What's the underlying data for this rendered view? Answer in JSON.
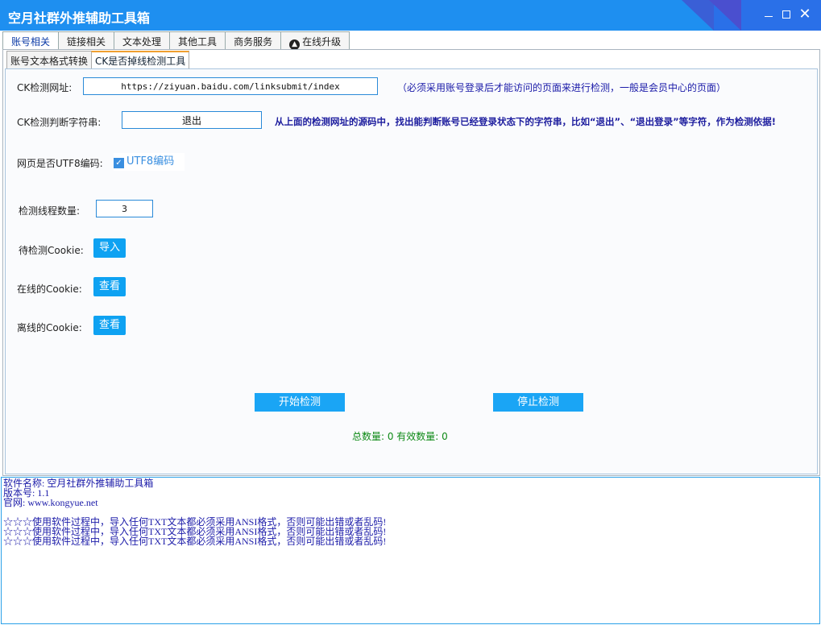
{
  "window": {
    "title": "空月社群外推辅助工具箱",
    "accent": "#1e8ff0"
  },
  "main_tabs": [
    {
      "label": "账号相关",
      "active": true
    },
    {
      "label": "链接相关",
      "active": false
    },
    {
      "label": "文本处理",
      "active": false
    },
    {
      "label": "其他工具",
      "active": false
    },
    {
      "label": "商务服务",
      "active": false
    },
    {
      "label": "在线升级",
      "active": false,
      "icon": "upload-circle-icon"
    }
  ],
  "sub_tabs": [
    {
      "label": "账号文本格式转换",
      "active": false
    },
    {
      "label": "CK是否掉线检测工具",
      "active": true
    }
  ],
  "form": {
    "url_label": "CK检测网址:",
    "url_value": "https://ziyuan.baidu.com/linksubmit/index",
    "url_hint": "（必须采用账号登录后才能访问的页面来进行检测，一般是会员中心的页面）",
    "keyword_label": "CK检测判断字符串:",
    "keyword_value": "退出",
    "keyword_hint": "从上面的检测网址的源码中，找出能判断账号已经登录状态下的字符串，比如“退出”、“退出登录”等字符，作为检测依据!",
    "utf8_label": "网页是否UTF8编码:",
    "utf8_checkbox_label": "UTF8编码",
    "utf8_checked": true,
    "threads_label": "检测线程数量:",
    "threads_value": "3",
    "pending_label": "待检测Cookie:",
    "pending_button": "导入",
    "online_label": "在线的Cookie:",
    "online_button": "查看",
    "offline_label": "离线的Cookie:",
    "offline_button": "查看",
    "start_button": "开始检测",
    "stop_button": "停止检测",
    "counts_text": "总数量: 0  有效数量: 0"
  },
  "log": {
    "lines": [
      "软件名称: 空月社群外推辅助工具箱",
      "版本号: 1.1",
      "官网: www.kongyue.net",
      "",
      "☆☆☆使用软件过程中，导入任何TXT文本都必须采用ANSI格式，否则可能出错或者乱码!",
      "☆☆☆使用软件过程中，导入任何TXT文本都必须采用ANSI格式，否则可能出错或者乱码!",
      "☆☆☆使用软件过程中，导入任何TXT文本都必须采用ANSI格式，否则可能出错或者乱码!"
    ]
  }
}
